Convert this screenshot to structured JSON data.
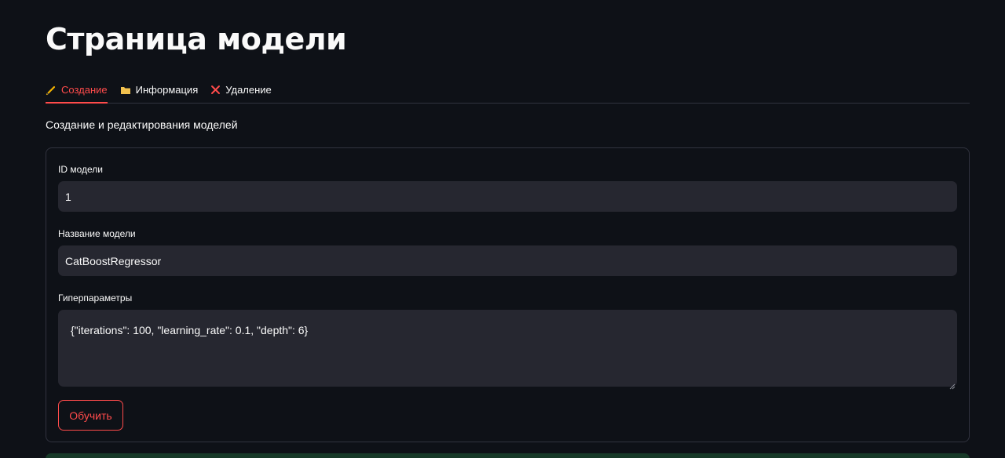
{
  "page": {
    "title": "Страница модели",
    "tabs": [
      {
        "label": "Создание",
        "icon": "pencil-icon",
        "active": true
      },
      {
        "label": "Информация",
        "icon": "folder-icon",
        "active": false
      },
      {
        "label": "Удаление",
        "icon": "cross-icon",
        "active": false
      }
    ],
    "caption": "Создание и редактирования моделей"
  },
  "form": {
    "model_id": {
      "label": "ID модели",
      "value": "1"
    },
    "model_name": {
      "label": "Название модели",
      "value": "CatBoostRegressor"
    },
    "hyperparams": {
      "label": "Гиперпараметры",
      "value": "{\"iterations\": 100, \"learning_rate\": 0.1, \"depth\": 6}"
    },
    "submit_label": "Обучить"
  },
  "colors": {
    "background": "#0e1117",
    "accent": "#ff4b4b",
    "input_bg": "#262730",
    "border": "#31333f",
    "success_bg": "#173928"
  }
}
